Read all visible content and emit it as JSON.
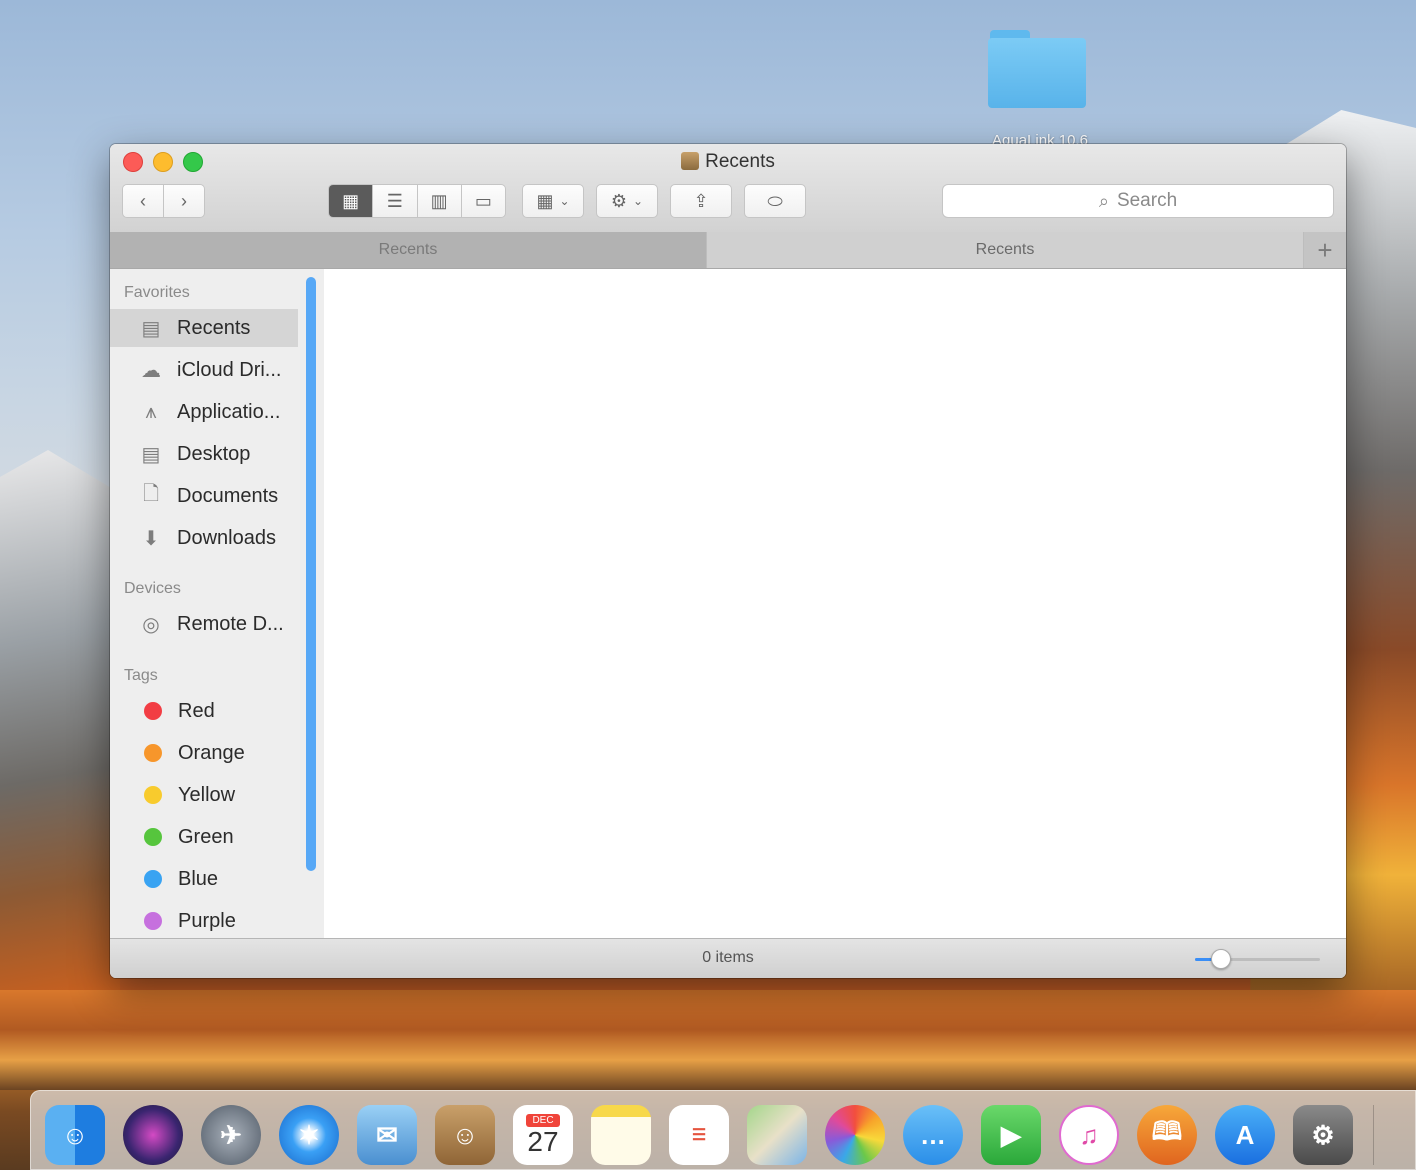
{
  "desktop": {
    "folder_label": "AquaLink 10.6"
  },
  "window": {
    "title": "Recents",
    "tabs": [
      {
        "label": "Recents"
      },
      {
        "label": "Recents"
      }
    ],
    "add_tab_icon": "plus-icon",
    "search_placeholder": "Search",
    "status": "0 items",
    "zoom_slider_value": 0.2
  },
  "sidebar": {
    "favorites_header": "Favorites",
    "favorites": [
      {
        "label": "Recents",
        "icon": "recents-icon",
        "selected": true
      },
      {
        "label": "iCloud Dri...",
        "icon": "cloud-icon"
      },
      {
        "label": "Applicatio...",
        "icon": "applications-icon"
      },
      {
        "label": "Desktop",
        "icon": "desktop-icon"
      },
      {
        "label": "Documents",
        "icon": "documents-icon"
      },
      {
        "label": "Downloads",
        "icon": "downloads-icon"
      }
    ],
    "devices_header": "Devices",
    "devices": [
      {
        "label": "Remote D...",
        "icon": "disc-icon"
      }
    ],
    "tags_header": "Tags",
    "tags": [
      {
        "label": "Red",
        "color": "#f23d44"
      },
      {
        "label": "Orange",
        "color": "#f7962b"
      },
      {
        "label": "Yellow",
        "color": "#f8cb2d"
      },
      {
        "label": "Green",
        "color": "#56c53d"
      },
      {
        "label": "Blue",
        "color": "#39a3f2"
      },
      {
        "label": "Purple",
        "color": "#c670de"
      }
    ]
  },
  "dock": {
    "apps": [
      {
        "name": "finder-icon",
        "color": "#3b8fe8"
      },
      {
        "name": "siri-icon",
        "color": "#4a2f80"
      },
      {
        "name": "launchpad-icon",
        "color": "#5f6a78"
      },
      {
        "name": "safari-icon",
        "color": "#1f86e8"
      },
      {
        "name": "mail-icon",
        "color": "#6fb3ea"
      },
      {
        "name": "contacts-icon",
        "color": "#b08448"
      },
      {
        "name": "calendar-icon",
        "color": "#ffffff",
        "month": "DEC",
        "day": "27"
      },
      {
        "name": "notes-icon",
        "color": "#f7d84a"
      },
      {
        "name": "reminders-icon",
        "color": "#ffffff"
      },
      {
        "name": "maps-icon",
        "color": "#9ccc6a"
      },
      {
        "name": "photos-icon",
        "color": "#ffffff"
      },
      {
        "name": "messages-icon",
        "color": "#46a6f4"
      },
      {
        "name": "facetime-icon",
        "color": "#3fbd4a"
      },
      {
        "name": "itunes-icon",
        "color": "#f4f4f4"
      },
      {
        "name": "ibooks-icon",
        "color": "#f0902b"
      },
      {
        "name": "app-store-icon",
        "color": "#1f8ef1"
      },
      {
        "name": "system-preferences-icon",
        "color": "#6b6b6b"
      }
    ]
  }
}
